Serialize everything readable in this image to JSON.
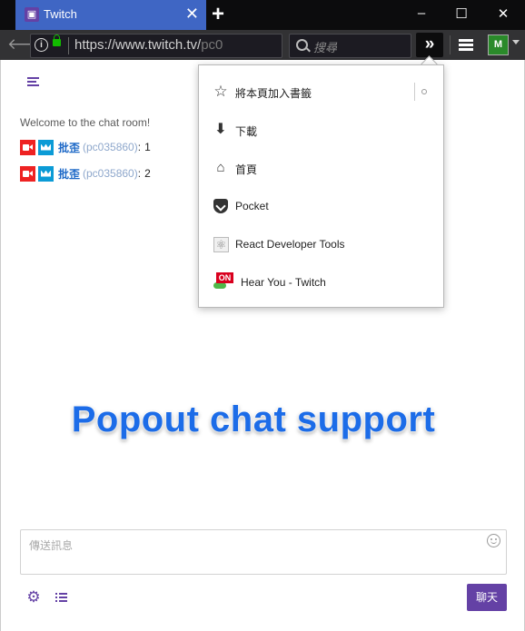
{
  "browser": {
    "tab_title": "Twitch",
    "tab_favicon": "twitch-logo-icon",
    "url_main": "https://www.twitch.tv/",
    "url_tail": "pc0",
    "search_placeholder": "搜尋",
    "overflow_symbol": "»",
    "new_tab_symbol": "+",
    "window_controls": {
      "minimize": "–",
      "maximize": "☐",
      "close": "✕"
    },
    "extension_icon": "M"
  },
  "overflow_menu": {
    "items": [
      {
        "label": "將本頁加入書籤",
        "icon": "star-icon"
      },
      {
        "label": "下載",
        "icon": "download-icon"
      },
      {
        "label": "首頁",
        "icon": "home-icon"
      },
      {
        "label": "Pocket",
        "icon": "pocket-icon"
      },
      {
        "label": "React Developer Tools",
        "icon": "react-devtools-icon"
      },
      {
        "label": "Hear You - Twitch",
        "icon": "hear-you-icon",
        "flag": "ON"
      }
    ]
  },
  "chat": {
    "welcome": "Welcome to the chat room!",
    "messages": [
      {
        "display_name": "批歪",
        "login": "(pc035860)",
        "colon": ":",
        "text": "1"
      },
      {
        "display_name": "批歪",
        "login": "(pc035860)",
        "colon": ":",
        "text": "2"
      }
    ],
    "input_placeholder": "傳送訊息",
    "send_button": "聊天"
  },
  "overlay_title": "Popout chat support",
  "colors": {
    "twitch_purple": "#6441a5",
    "firefox_tab_blue": "#3f66c4",
    "overlay_blue": "#1c6ce8",
    "username_blue": "#1e69c7"
  }
}
